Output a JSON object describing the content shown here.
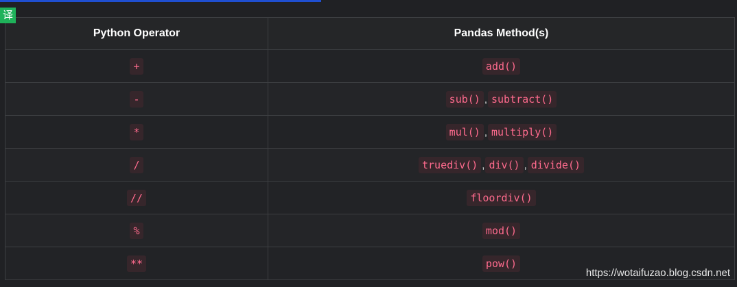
{
  "badge": {
    "label": "译"
  },
  "table": {
    "headers": [
      "Python Operator",
      "Pandas Method(s)"
    ],
    "rows": [
      {
        "operator": "+",
        "methods": [
          "add()"
        ]
      },
      {
        "operator": "-",
        "methods": [
          "sub()",
          "subtract()"
        ]
      },
      {
        "operator": "*",
        "methods": [
          "mul()",
          "multiply()"
        ]
      },
      {
        "operator": "/",
        "methods": [
          "truediv()",
          "div()",
          "divide()"
        ]
      },
      {
        "operator": "//",
        "methods": [
          "floordiv()"
        ]
      },
      {
        "operator": "%",
        "methods": [
          "mod()"
        ]
      },
      {
        "operator": "**",
        "methods": [
          "pow()"
        ]
      }
    ],
    "separator": ","
  },
  "watermark": "https://wotaifuzao.blog.csdn.net",
  "colors": {
    "background": "#202124",
    "code_text": "#ff6b8e",
    "code_bg": "#36262b",
    "top_bar": "#1f4fd1",
    "badge": "#1fb25a"
  }
}
